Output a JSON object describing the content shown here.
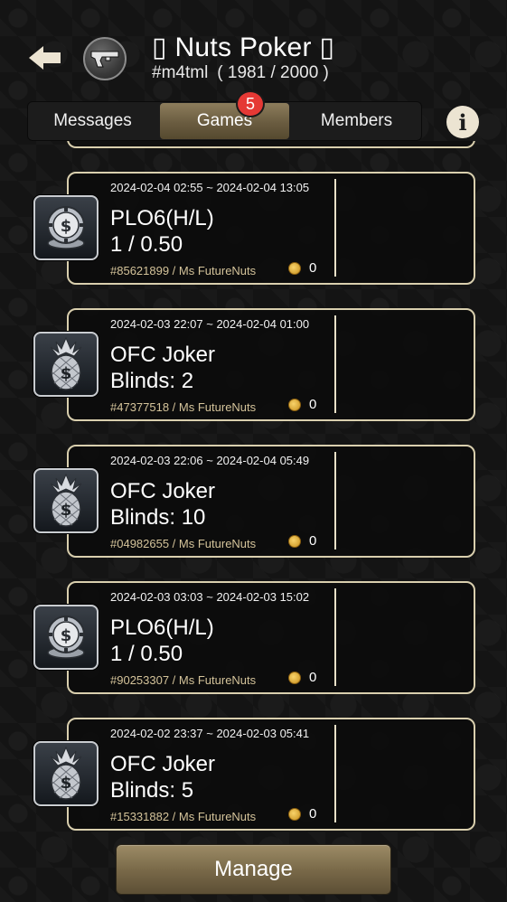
{
  "header": {
    "title": "▯ Nuts Poker ▯",
    "club_id": "#m4tml",
    "member_count": "( 1981 / 2000 )",
    "back_icon": "arrow-left-icon",
    "avatar_icon": "pistol-icon",
    "info_label": "i"
  },
  "tabs": {
    "messages": "Messages",
    "games": "Games",
    "members": "Members",
    "games_badge": "5",
    "active": "Games"
  },
  "games": [
    {
      "time": "2024-02-04 02:55 ~ 2024-02-04 13:05",
      "name": "PLO6(H/L)",
      "stakes": "1 / 0.50",
      "owner": "#85621899 / Ms FutureNuts",
      "coins": "0",
      "icon": "chip-icon"
    },
    {
      "time": "2024-02-03 22:07 ~ 2024-02-04 01:00",
      "name": "OFC Joker",
      "stakes": "Blinds: 2",
      "owner": "#47377518 / Ms FutureNuts",
      "coins": "0",
      "icon": "pineapple-icon"
    },
    {
      "time": "2024-02-03 22:06 ~ 2024-02-04 05:49",
      "name": "OFC Joker",
      "stakes": "Blinds: 10",
      "owner": "#04982655 / Ms FutureNuts",
      "coins": "0",
      "icon": "pineapple-icon"
    },
    {
      "time": "2024-02-03 03:03 ~ 2024-02-03 15:02",
      "name": "PLO6(H/L)",
      "stakes": "1 / 0.50",
      "owner": "#90253307 / Ms FutureNuts",
      "coins": "0",
      "icon": "chip-icon"
    },
    {
      "time": "2024-02-02 23:37 ~ 2024-02-03 05:41",
      "name": "OFC Joker",
      "stakes": "Blinds: 5",
      "owner": "#15331882 / Ms FutureNuts",
      "coins": "0",
      "icon": "pineapple-icon"
    }
  ],
  "footer": {
    "manage_label": "Manage"
  },
  "colors": {
    "accent_gold": "#d9cfae",
    "tab_active": "#7a6a49",
    "badge_red": "#e53935",
    "owner_text": "#d4c39a",
    "background": "#141414"
  }
}
